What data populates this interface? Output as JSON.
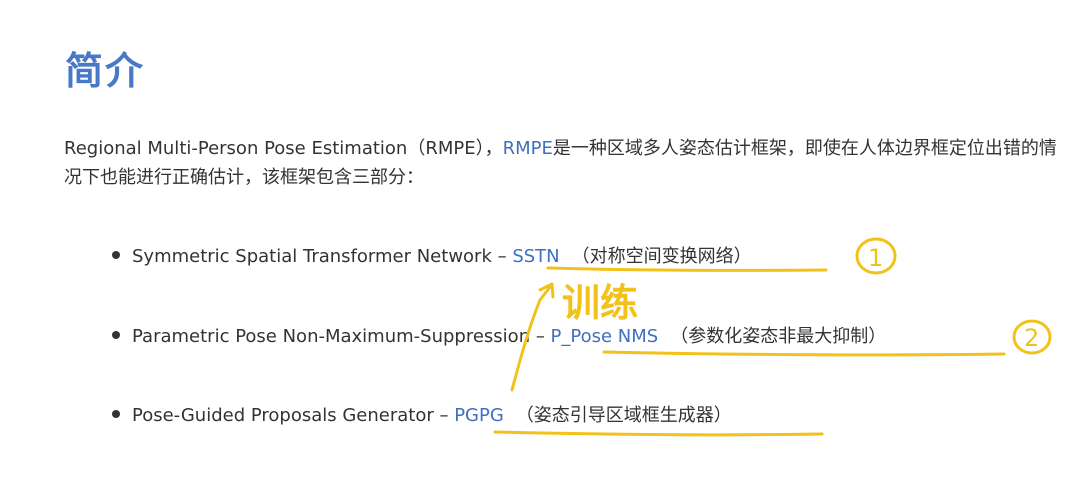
{
  "heading": "简介",
  "intro": {
    "part1": "Regional Multi-Person Pose Estimation（RMPE），",
    "link": "RMPE",
    "part2": "是一种区域多人姿态估计框架，即使在人体边界框定位出错的情况下也能进行正确估计，该框架包含三部分："
  },
  "components": [
    {
      "name": "Symmetric Spatial Transformer Network – ",
      "abbr": "SSTN",
      "zh": "（对称空间变换网络）"
    },
    {
      "name": "Parametric Pose Non-Maximum-Suppression – ",
      "abbr": "P_Pose NMS",
      "zh": "（参数化姿态非最大抑制）"
    },
    {
      "name": "Pose-Guided Proposals Generator – ",
      "abbr": "PGPG",
      "zh": "（姿态引导区域框生成器）"
    }
  ],
  "annotations": {
    "mark1": "1",
    "mark2": "2",
    "handwritten": "训练"
  },
  "colors": {
    "heading": "#4a78c9",
    "link": "#3f6fc1",
    "ink": "#f2c21a",
    "text": "#333333"
  }
}
